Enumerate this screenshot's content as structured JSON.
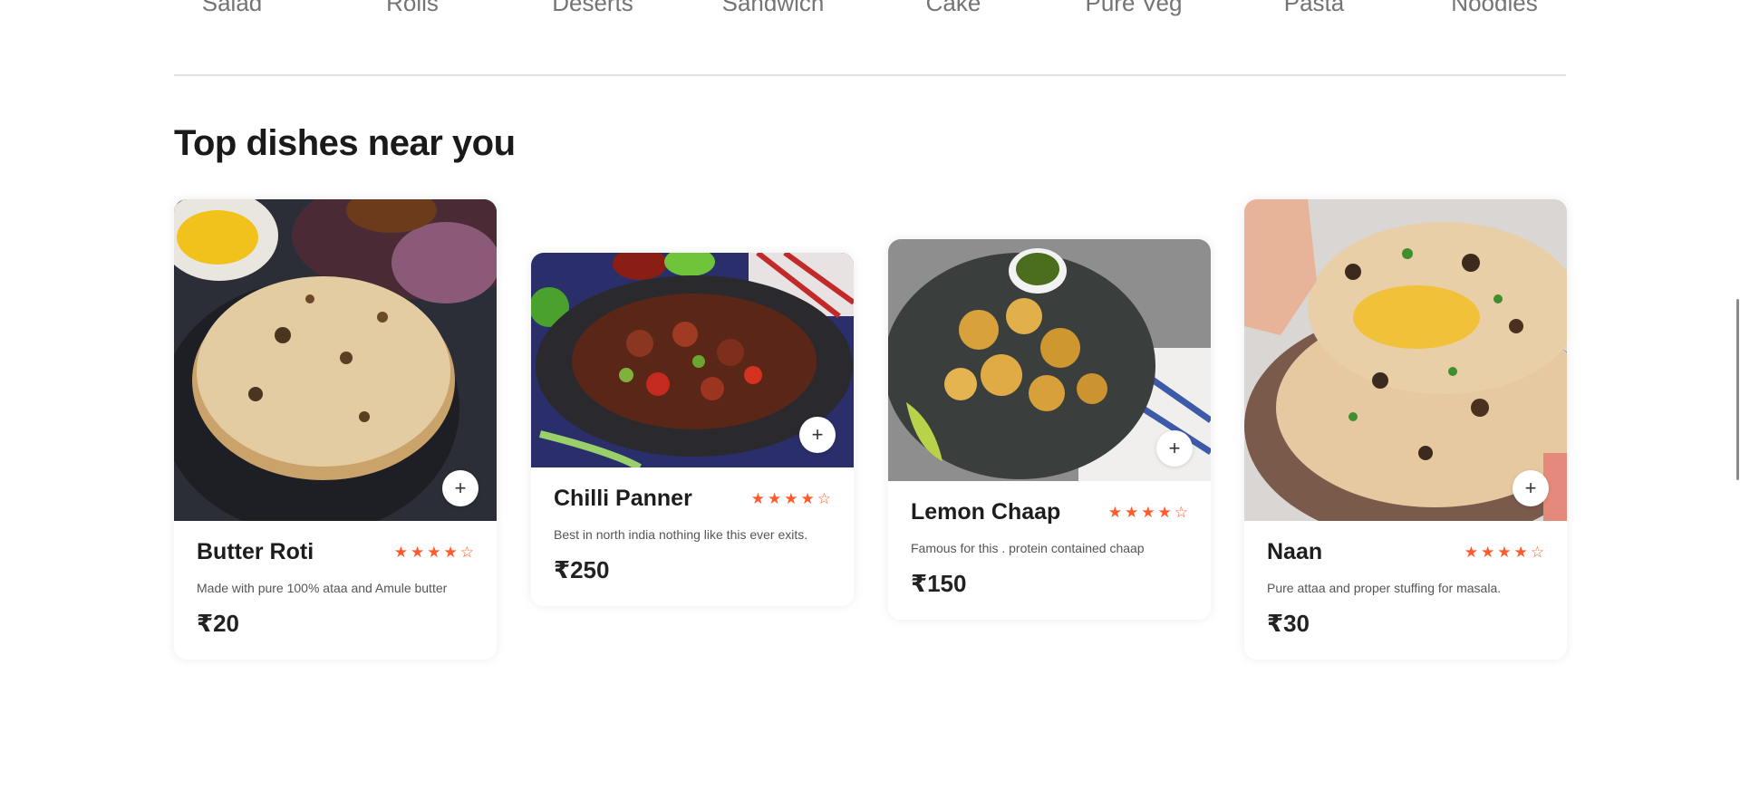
{
  "menu": {
    "items": [
      "Salad",
      "Rolls",
      "Deserts",
      "Sandwich",
      "Cake",
      "Pure Veg",
      "Pasta",
      "Noodles"
    ]
  },
  "section": {
    "title": "Top dishes near you"
  },
  "dishes": [
    {
      "name": "Butter Roti",
      "description": "Made with pure 100% ataa and Amule butter",
      "price": "₹20",
      "rating": 4,
      "add_label": "+"
    },
    {
      "name": "Chilli Panner",
      "description": "Best in north india nothing like this ever exits.",
      "price": "₹250",
      "rating": 4,
      "add_label": "+"
    },
    {
      "name": "Lemon Chaap",
      "description": "Famous for this . protein contained chaap",
      "price": "₹150",
      "rating": 4,
      "add_label": "+"
    },
    {
      "name": "Naan",
      "description": "Pure attaa and proper stuffing for masala.",
      "price": "₹30",
      "rating": 4,
      "add_label": "+"
    }
  ],
  "colors": {
    "star": "#ff5a2c",
    "divider": "#e2e2e2"
  }
}
